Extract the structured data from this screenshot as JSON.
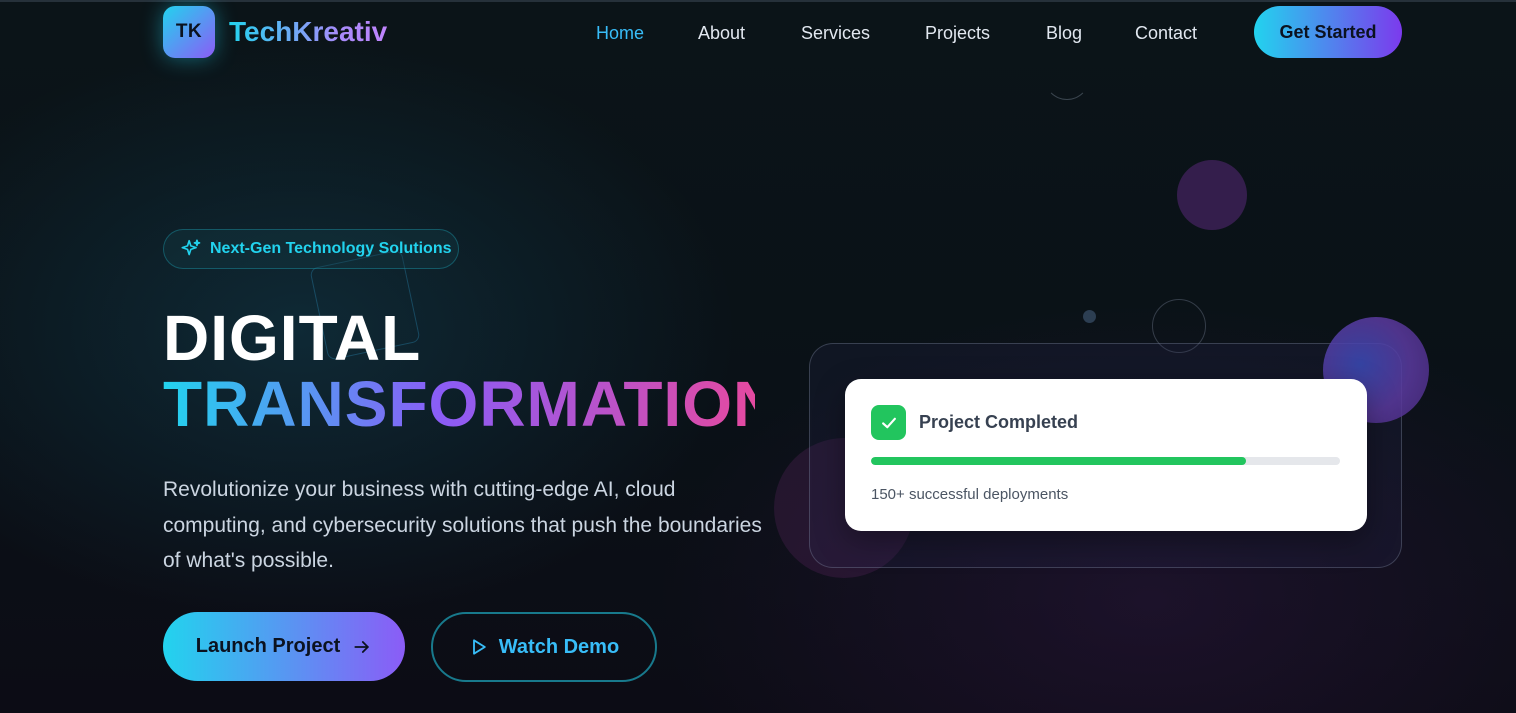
{
  "brand": {
    "badge": "TK",
    "name": "TechKreativ"
  },
  "nav": {
    "items": [
      {
        "label": "Home",
        "active": true
      },
      {
        "label": "About",
        "active": false
      },
      {
        "label": "Services",
        "active": false
      },
      {
        "label": "Projects",
        "active": false
      },
      {
        "label": "Blog",
        "active": false
      },
      {
        "label": "Contact",
        "active": false
      }
    ],
    "cta_label": "Get Started"
  },
  "hero": {
    "tag": {
      "icon": "sparkle-icon",
      "text": "Next-Gen Technology Solutions"
    },
    "title_line1": "DIGITAL",
    "title_line2": "TRANSFORMATION",
    "description": "Revolutionize your business with cutting-edge AI, cloud computing, and cybersecurity solutions that push the boundaries of what's possible.",
    "primary_button": {
      "label": "Launch Project",
      "icon": "arrow-right-icon"
    },
    "secondary_button": {
      "label": "Watch Demo",
      "icon": "play-icon"
    }
  },
  "status_card": {
    "icon": "check-icon",
    "title": "Project Completed",
    "progress": 0.8,
    "subtitle": "150+ successful deployments"
  },
  "colors": {
    "accent_cyan": "#22d3ee",
    "accent_purple": "#8b5cf6",
    "accent_pink": "#ec4899",
    "success_green": "#22c55e",
    "background": "#0a1117"
  }
}
